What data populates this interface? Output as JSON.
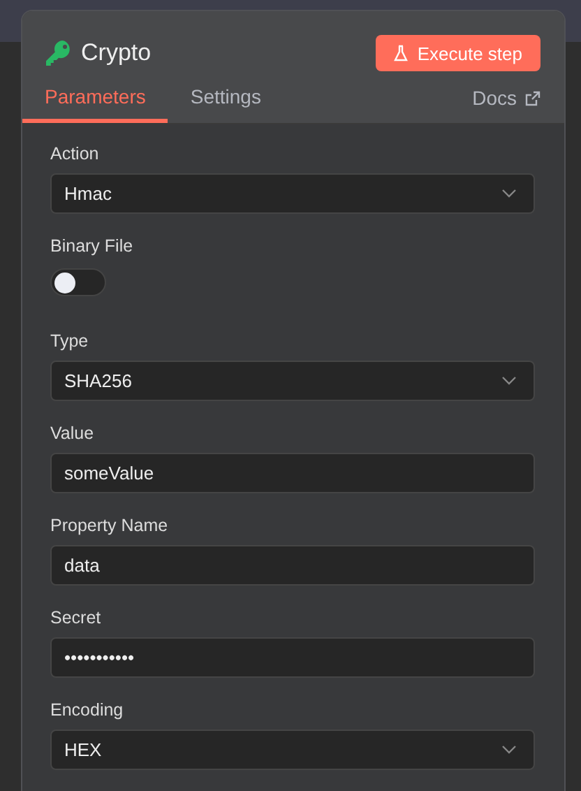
{
  "node": {
    "title": "Crypto",
    "execute_button": "Execute step"
  },
  "tabs": [
    {
      "label": "Parameters",
      "selected": true
    },
    {
      "label": "Settings",
      "selected": false
    }
  ],
  "docs_link": "Docs",
  "fields": [
    {
      "kind": "select",
      "label": "Action",
      "value": "Hmac"
    },
    {
      "kind": "toggle",
      "label": "Binary File",
      "on": false
    },
    {
      "kind": "select",
      "label": "Type",
      "value": "SHA256"
    },
    {
      "kind": "text",
      "label": "Value",
      "value": "someValue"
    },
    {
      "kind": "text",
      "label": "Property Name",
      "value": "data"
    },
    {
      "kind": "text",
      "label": "Secret",
      "value": "•••••••••••"
    },
    {
      "kind": "select",
      "label": "Encoding",
      "value": "HEX"
    }
  ]
}
